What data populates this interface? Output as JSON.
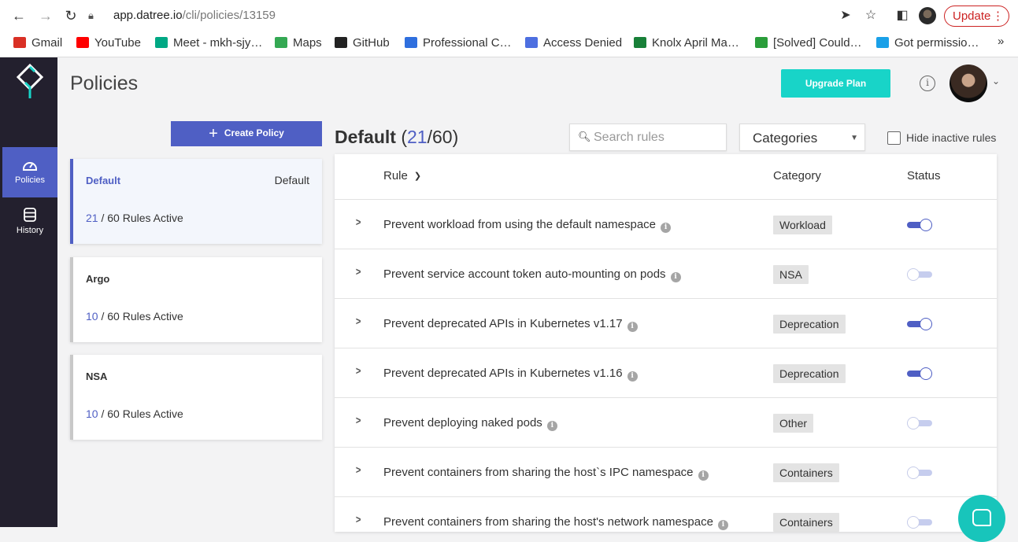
{
  "browser": {
    "url_host": "app.datree.io",
    "url_path": "/cli/policies/13159",
    "update_label": "Update",
    "bookmarks": [
      {
        "label": "Gmail",
        "color": "#d93025"
      },
      {
        "label": "YouTube",
        "color": "#ff0000"
      },
      {
        "label": "Meet - mkh-sjy…",
        "color": "#00a884"
      },
      {
        "label": "Maps",
        "color": "#34a853"
      },
      {
        "label": "GitHub",
        "color": "#222222"
      },
      {
        "label": "Professional C…",
        "color": "#2f6fde"
      },
      {
        "label": "Access Denied",
        "color": "#4d6fe0"
      },
      {
        "label": "Knolx April Ma…",
        "color": "#188038"
      },
      {
        "label": "[Solved] Could…",
        "color": "#2a9d3a"
      },
      {
        "label": "Got permissio…",
        "color": "#1aa0e8"
      }
    ]
  },
  "sidebar": {
    "items": [
      {
        "label": "Policies",
        "icon": "dashboard-gauge-icon",
        "active": true
      },
      {
        "label": "History",
        "icon": "database-stack-icon",
        "active": false
      }
    ]
  },
  "header": {
    "title": "Policies",
    "upgrade_label": "Upgrade Plan"
  },
  "policies": {
    "create_label": "Create Policy",
    "cards": [
      {
        "name": "Default",
        "tag": "Default",
        "active": "21",
        "rest": " / 60 Rules Active",
        "selected": true
      },
      {
        "name": "Argo",
        "tag": "",
        "active": "10",
        "rest": " / 60 Rules Active",
        "selected": false
      },
      {
        "name": "NSA",
        "tag": "",
        "active": "10",
        "rest": " / 60 Rules Active",
        "selected": false
      }
    ]
  },
  "rules": {
    "title": "Default",
    "count_open": "(",
    "active": "21",
    "total": "/60)",
    "search_placeholder": "Search rules",
    "categories_label": "Categories",
    "hide_inactive_label": "Hide inactive rules",
    "col_rule": "Rule",
    "col_category": "Category",
    "col_status": "Status",
    "rows": [
      {
        "name": "Prevent workload from using the default namespace",
        "category": "Workload",
        "enabled": true
      },
      {
        "name": "Prevent service account token auto-mounting on pods",
        "category": "NSA",
        "enabled": false
      },
      {
        "name": "Prevent deprecated APIs in Kubernetes v1.17",
        "category": "Deprecation",
        "enabled": true
      },
      {
        "name": "Prevent deprecated APIs in Kubernetes v1.16",
        "category": "Deprecation",
        "enabled": true
      },
      {
        "name": "Prevent deploying naked pods",
        "category": "Other",
        "enabled": false
      },
      {
        "name": "Prevent containers from sharing the host`s IPC namespace",
        "category": "Containers",
        "enabled": false
      },
      {
        "name": "Prevent containers from sharing the host's network namespace",
        "category": "Containers",
        "enabled": false
      }
    ]
  },
  "colors": {
    "accent": "#4f5fc4",
    "upgrade": "#18d4c8",
    "sidebar_bg": "#23202e"
  }
}
